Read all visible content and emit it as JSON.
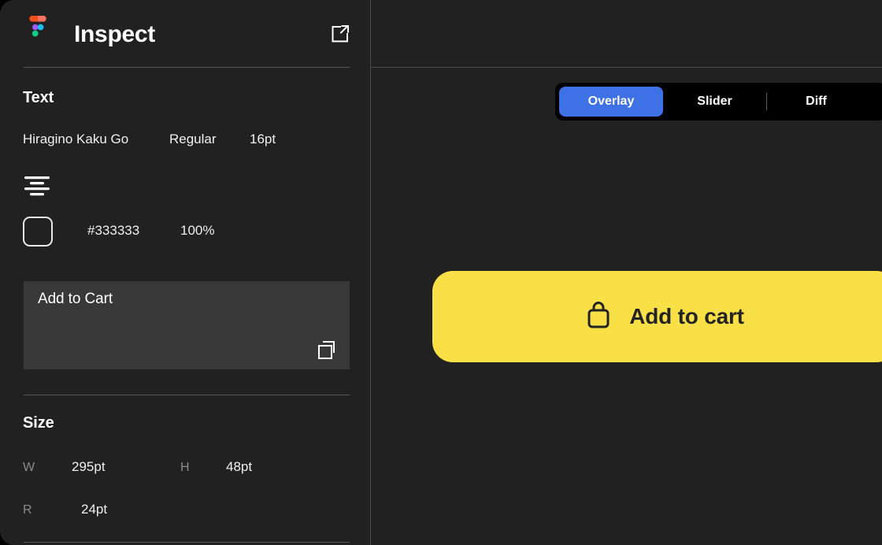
{
  "app": {
    "logo_icon": "figma-logo-icon",
    "title": "Inspect",
    "open_external_icon": "external-link-icon"
  },
  "left_panel": {
    "sections": {
      "text": {
        "heading": "Text",
        "font_family": "Hiragino Kaku Go",
        "font_weight": "Regular",
        "font_size": "16pt",
        "align_icon": "text-align-left-icon",
        "color_swatch_icon": "color-swatch-icon",
        "color_hex": "#333333",
        "color_opacity": "100%",
        "content_text": "Add to Cart",
        "copy_icon": "copy-icon"
      },
      "size": {
        "heading": "Size",
        "width_label": "W",
        "width_value": "295pt",
        "height_label": "H",
        "height_value": "48pt",
        "radius_label": "R",
        "radius_value": "24pt"
      }
    }
  },
  "right_panel": {
    "view_modes": [
      {
        "label": "Overlay",
        "active": true
      },
      {
        "label": "Slider",
        "active": false
      },
      {
        "label": "Diff",
        "active": false
      }
    ],
    "preview": {
      "button_label": "Add to cart",
      "button_icon": "shopping-bag-icon"
    }
  },
  "colors": {
    "accent_blue": "#3f71e6",
    "preview_yellow": "#f9e047",
    "panel_background": "#212121",
    "content_box_background": "#383838",
    "text_color_value": "#333333"
  }
}
